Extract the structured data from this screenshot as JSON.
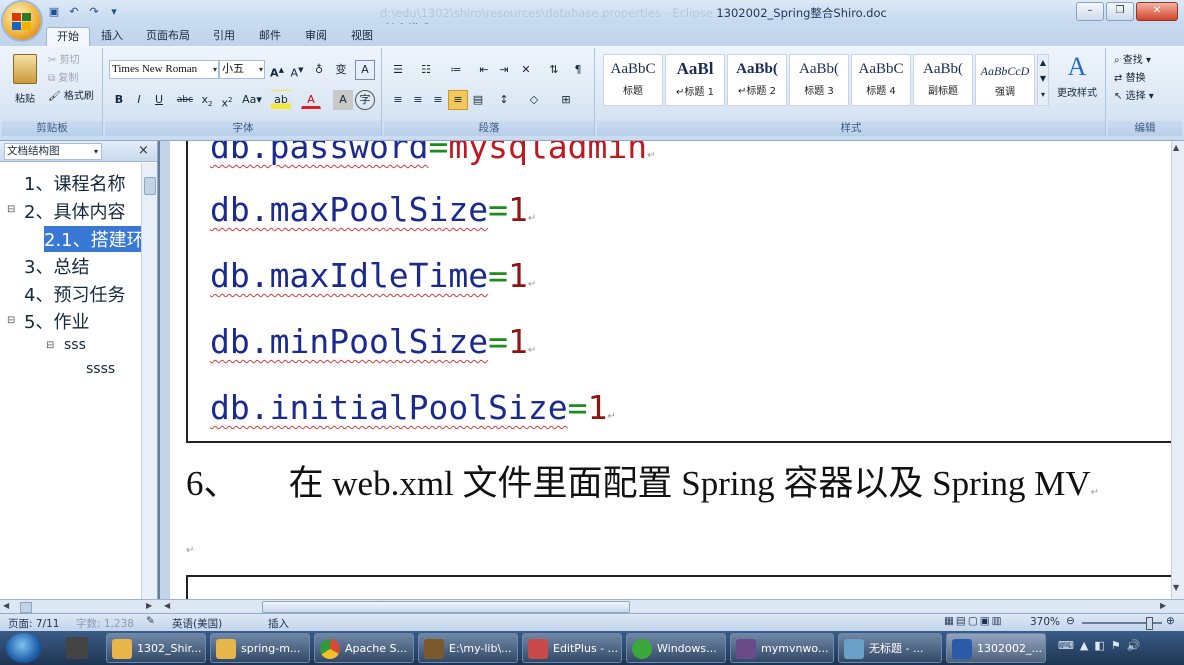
{
  "window": {
    "title_path": "d:\\edu\\1302\\shiro\\resources\\database.properties - Eclipse",
    "title": "1302002_Spring整合Shiro.doc [兼容模式] - Microsoft Word"
  },
  "tabs": [
    "开始",
    "插入",
    "页面布局",
    "引用",
    "邮件",
    "审阅",
    "视图"
  ],
  "ribbon": {
    "clipboard": {
      "paste": "粘贴",
      "cut": "剪切",
      "copy": "复制",
      "format_painter": "格式刷",
      "label": "剪贴板"
    },
    "font": {
      "name": "Times New Roman",
      "size": "小五",
      "label": "字体"
    },
    "paragraph": {
      "label": "段落"
    },
    "styles": {
      "items": [
        {
          "preview": "AaBbC",
          "name": "标题"
        },
        {
          "preview": "AaBl",
          "name": "↵标题 1"
        },
        {
          "preview": "AaBb(",
          "name": "↵标题 2"
        },
        {
          "preview": "AaBb(",
          "name": "标题 3"
        },
        {
          "preview": "AaBbC",
          "name": "标题 4"
        },
        {
          "preview": "AaBb(",
          "name": "副标题"
        },
        {
          "preview": "AaBbCcD",
          "name": "强调"
        }
      ],
      "change_styles": "更改样式",
      "label": "样式"
    },
    "editing": {
      "find": "查找",
      "replace": "替换",
      "select": "选择",
      "label": "编辑"
    }
  },
  "nav_pane": {
    "title": "文档结构图",
    "close": "×",
    "items": [
      {
        "text": "1、课程名称"
      },
      {
        "text": "2、具体内容"
      },
      {
        "text": "2.1、搭建环"
      },
      {
        "text": "3、总结"
      },
      {
        "text": "4、预习任务"
      },
      {
        "text": "5、作业"
      },
      {
        "text": "sss"
      },
      {
        "text": "ssss"
      }
    ]
  },
  "document": {
    "top_partial": {
      "key": "db.password",
      "eq": "=",
      "value": "mysqladmin"
    },
    "lines": [
      {
        "key": "db.maxPoolSize",
        "eq": "=",
        "value": "1"
      },
      {
        "key": "db.maxIdleTime",
        "eq": "=",
        "value": "1"
      },
      {
        "key": "db.minPoolSize",
        "eq": "=",
        "value": "1"
      },
      {
        "key": "db.initialPoolSize",
        "eq": "=",
        "value": "1"
      }
    ],
    "paragraph_mark": "↵",
    "heading": {
      "number": "6、",
      "text": "在 web.xml 文件里面配置 Spring 容器以及 Spring MV"
    }
  },
  "status": {
    "page": "页面: 7/11",
    "words": "字数: 1,238",
    "language": "英语(美国)",
    "mode": "插入",
    "zoom": "370%"
  },
  "taskbar": {
    "items": [
      {
        "label": "1302_Shir...",
        "icon_color": "#e7b64a"
      },
      {
        "label": "spring-m...",
        "icon_color": "#e7b64a"
      },
      {
        "label": "Apache S...",
        "icon_color": "#d44b3a"
      },
      {
        "label": "E:\\my-lib\\...",
        "icon_color": "#7a5a2a"
      },
      {
        "label": "EditPlus - ...",
        "icon_color": "#c84a4a"
      },
      {
        "label": "Windows...",
        "icon_color": "#3aa83a"
      },
      {
        "label": "mymvnwo...",
        "icon_color": "#6a4a8a"
      },
      {
        "label": "无标题 - ...",
        "icon_color": "#6aa0c8"
      },
      {
        "label": "1302002_...",
        "icon_color": "#2a5aa8"
      }
    ]
  }
}
